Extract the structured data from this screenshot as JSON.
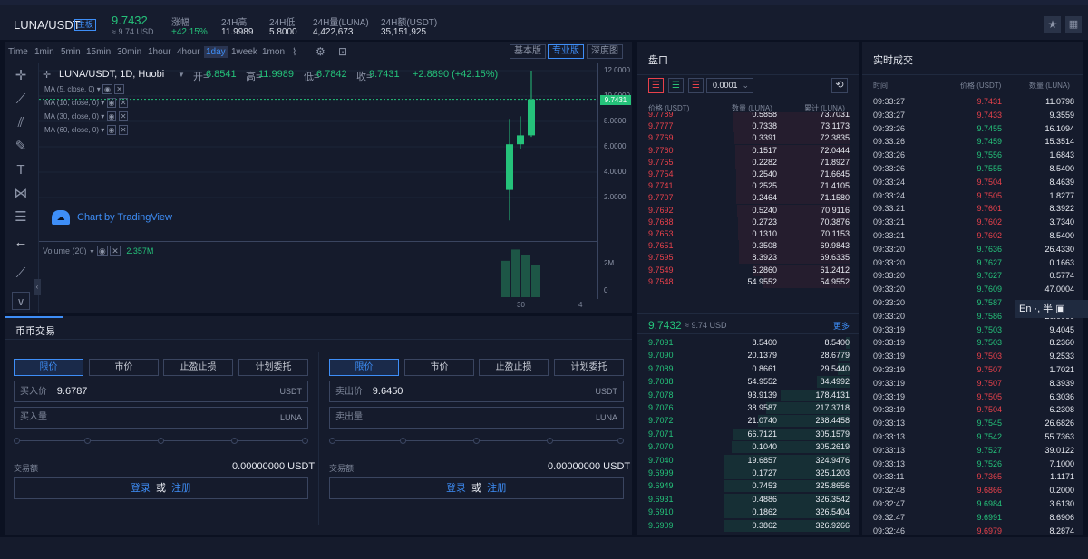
{
  "header": {
    "pair": "LUNA/USDT",
    "zone_badge": "主板",
    "last_price": "9.7432",
    "last_price_usd": "≈ 9.74 USD",
    "change_label": "涨幅",
    "change_value": "+42.15%",
    "high_label": "24H高",
    "high_value": "11.9989",
    "low_label": "24H低",
    "low_value": "5.8000",
    "vol_label": "24H量(LUNA)",
    "vol_value": "4,422,673",
    "amount_label": "24H额(USDT)",
    "amount_value": "35,151,925"
  },
  "chart": {
    "timeframes": [
      "Time",
      "1min",
      "5min",
      "15min",
      "30min",
      "1hour",
      "4hour",
      "1day",
      "1week",
      "1mon"
    ],
    "active_timeframe": "1day",
    "view_buttons": [
      "基本版",
      "专业版",
      "深度图"
    ],
    "active_view": "专业版",
    "legend_title": "LUNA/USDT, 1D, Huobi",
    "ohlc": {
      "open_label": "开=",
      "open": "6.8541",
      "high_label": "高=",
      "high": "11.9989",
      "low_label": "低=",
      "low": "6.7842",
      "close_label": "收=",
      "close": "9.7431",
      "change": "+2.8890 (+42.15%)"
    },
    "ma_lines": [
      "MA (5, close, 0)",
      "MA (10, close, 0)",
      "MA (30, close, 0)",
      "MA (60, close, 0)"
    ],
    "watermark": "Chart by TradingView",
    "volume_label": "Volume (20)",
    "volume_value": "2.357M",
    "price_tag": "9.7431",
    "y_ticks": [
      "12.0000",
      "10.0000",
      "8.0000",
      "6.0000",
      "4.0000",
      "2.0000"
    ],
    "vol_ticks": [
      "2M",
      "0"
    ],
    "x_ticks": [
      "30",
      "4"
    ]
  },
  "chart_data": {
    "type": "candlestick",
    "ylim": [
      0,
      12
    ],
    "candles": [
      {
        "open": 2.6,
        "close": 6.2,
        "high": 8.2,
        "low": 0.2
      },
      {
        "open": 6.2,
        "close": 6.9,
        "high": 8.4,
        "low": 5.8
      },
      {
        "open": 6.9,
        "close": 9.74,
        "high": 12.0,
        "low": 6.78
      }
    ],
    "volume_ylim": [
      0,
      2.6
    ],
    "volumes": [
      1.8,
      2.357,
      2.1,
      1.6
    ]
  },
  "trade": {
    "tab_label": "币币交易",
    "order_types": [
      "限价",
      "市价",
      "止盈止损",
      "计划委托"
    ],
    "buy": {
      "price_label": "买入价",
      "price_value": "9.6787",
      "unit": "USDT",
      "amount_label": "买入量",
      "amount_unit": "LUNA",
      "total_label": "交易额",
      "total_value": "0.00000000 USDT"
    },
    "sell": {
      "price_label": "卖出价",
      "price_value": "9.6450",
      "unit": "USDT",
      "amount_label": "卖出量",
      "amount_unit": "LUNA",
      "total_label": "交易额",
      "total_value": "0.00000000 USDT"
    },
    "login": "登录",
    "or": "或",
    "register": "注册"
  },
  "book": {
    "title": "盘口",
    "precision": "0.0001",
    "col_price": "价格 (USDT)",
    "col_qty": "数量 (LUNA)",
    "col_cum": "累计 (LUNA)",
    "asks": [
      [
        "9.7789",
        "0.5858",
        "73.7031"
      ],
      [
        "9.7777",
        "0.7338",
        "73.1173"
      ],
      [
        "9.7769",
        "0.3391",
        "72.3835"
      ],
      [
        "9.7760",
        "0.1517",
        "72.0444"
      ],
      [
        "9.7755",
        "0.2282",
        "71.8927"
      ],
      [
        "9.7754",
        "0.2540",
        "71.6645"
      ],
      [
        "9.7741",
        "0.2525",
        "71.4105"
      ],
      [
        "9.7707",
        "0.2464",
        "71.1580"
      ],
      [
        "9.7692",
        "0.5240",
        "70.9116"
      ],
      [
        "9.7688",
        "0.2723",
        "70.3876"
      ],
      [
        "9.7653",
        "0.1310",
        "70.1153"
      ],
      [
        "9.7651",
        "0.3508",
        "69.9843"
      ],
      [
        "9.7595",
        "8.3923",
        "69.6335"
      ],
      [
        "9.7549",
        "6.2860",
        "61.2412"
      ],
      [
        "9.7548",
        "54.9552",
        "54.9552"
      ]
    ],
    "mid_price": "9.7432",
    "mid_usd": "≈ 9.74 USD",
    "more": "更多",
    "bids": [
      [
        "9.7091",
        "8.5400",
        "8.5400"
      ],
      [
        "9.7090",
        "20.1379",
        "28.6779"
      ],
      [
        "9.7089",
        "0.8661",
        "29.5440"
      ],
      [
        "9.7088",
        "54.9552",
        "84.4992"
      ],
      [
        "9.7078",
        "93.9139",
        "178.4131"
      ],
      [
        "9.7076",
        "38.9587",
        "217.3718"
      ],
      [
        "9.7072",
        "21.0740",
        "238.4458"
      ],
      [
        "9.7071",
        "66.7121",
        "305.1579"
      ],
      [
        "9.7070",
        "0.1040",
        "305.2619"
      ],
      [
        "9.7040",
        "19.6857",
        "324.9476"
      ],
      [
        "9.6999",
        "0.1727",
        "325.1203"
      ],
      [
        "9.6949",
        "0.7453",
        "325.8656"
      ],
      [
        "9.6931",
        "0.4886",
        "326.3542"
      ],
      [
        "9.6910",
        "0.1862",
        "326.5404"
      ],
      [
        "9.6909",
        "0.3862",
        "326.9266"
      ]
    ]
  },
  "trades": {
    "title": "实时成交",
    "col_time": "时间",
    "col_price": "价格 (USDT)",
    "col_qty": "数量 (LUNA)",
    "rows": [
      [
        "09:33:27",
        "9.7431",
        "11.0798",
        "r"
      ],
      [
        "09:33:27",
        "9.7433",
        "9.3559",
        "r"
      ],
      [
        "09:33:26",
        "9.7455",
        "16.1094",
        "g"
      ],
      [
        "09:33:26",
        "9.7459",
        "15.3514",
        "g"
      ],
      [
        "09:33:26",
        "9.7556",
        "1.6843",
        "g"
      ],
      [
        "09:33:26",
        "9.7555",
        "8.5400",
        "g"
      ],
      [
        "09:33:24",
        "9.7504",
        "8.4639",
        "r"
      ],
      [
        "09:33:24",
        "9.7505",
        "1.8277",
        "r"
      ],
      [
        "09:33:21",
        "9.7601",
        "8.3922",
        "r"
      ],
      [
        "09:33:21",
        "9.7602",
        "3.7340",
        "r"
      ],
      [
        "09:33:21",
        "9.7602",
        "8.5400",
        "r"
      ],
      [
        "09:33:20",
        "9.7636",
        "26.4330",
        "g"
      ],
      [
        "09:33:20",
        "9.7627",
        "0.1663",
        "g"
      ],
      [
        "09:33:20",
        "9.7627",
        "0.5774",
        "g"
      ],
      [
        "09:33:20",
        "9.7609",
        "47.0004",
        "g"
      ],
      [
        "09:33:20",
        "9.7587",
        "",
        "g"
      ],
      [
        "09:33:20",
        "9.7586",
        "20.0000",
        "g"
      ],
      [
        "09:33:19",
        "9.7503",
        "9.4045",
        "g"
      ],
      [
        "09:33:19",
        "9.7503",
        "8.2360",
        "g"
      ],
      [
        "09:33:19",
        "9.7503",
        "9.2533",
        "r"
      ],
      [
        "09:33:19",
        "9.7507",
        "1.7021",
        "r"
      ],
      [
        "09:33:19",
        "9.7507",
        "8.3939",
        "r"
      ],
      [
        "09:33:19",
        "9.7505",
        "6.3036",
        "r"
      ],
      [
        "09:33:19",
        "9.7504",
        "6.2308",
        "r"
      ],
      [
        "09:33:13",
        "9.7545",
        "26.6826",
        "g"
      ],
      [
        "09:33:13",
        "9.7542",
        "55.7363",
        "g"
      ],
      [
        "09:33:13",
        "9.7527",
        "39.0122",
        "g"
      ],
      [
        "09:33:13",
        "9.7526",
        "7.1000",
        "g"
      ],
      [
        "09:33:11",
        "9.7365",
        "1.1171",
        "r"
      ],
      [
        "09:32:48",
        "9.6866",
        "0.2000",
        "r"
      ],
      [
        "09:32:47",
        "9.6984",
        "3.6130",
        "g"
      ],
      [
        "09:32:47",
        "9.6991",
        "8.6906",
        "g"
      ],
      [
        "09:32:46",
        "9.6979",
        "8.2874",
        "r"
      ]
    ]
  },
  "ime": {
    "text": "En ·, 半"
  },
  "colors": {
    "up": "#25c27a",
    "down": "#e8414b",
    "accent": "#3e8ef7",
    "bg": "#0b1121",
    "panel": "#151b2c"
  }
}
